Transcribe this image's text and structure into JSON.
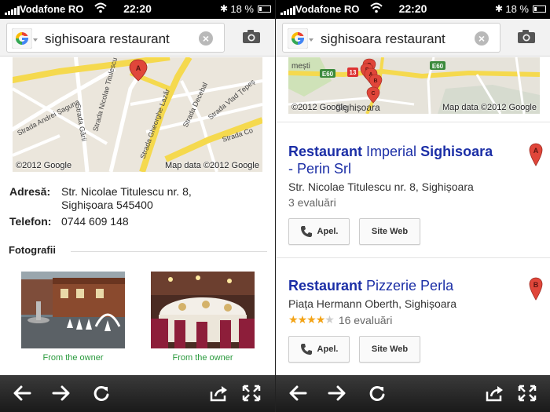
{
  "status_bar": {
    "carrier": "Vodafone RO",
    "time": "22:20",
    "battery": "18 %"
  },
  "search": {
    "query": "sighisoara restaurant",
    "clear_icon": "clear-x-icon",
    "camera_icon": "camera-icon"
  },
  "left_page": {
    "map": {
      "credit_left": "©2012 Google",
      "credit_right": "Map data ©2012 Google",
      "marker_letter": "A",
      "street_labels": [
        "Strada Gării",
        "Strada Nicolae Titulescu",
        "Strada Gheorghe Lazăr",
        "Strada Decebal",
        "Strada Vlad Țepeș",
        "Strada Andrei Șaguna",
        "Strada Co"
      ]
    },
    "address_label": "Adresă:",
    "address_line1": "Str. Nicolae Titulescu nr. 8,",
    "address_line2": "Sighișoara 545400",
    "phone_label": "Telefon:",
    "phone_value": "0744 609 148",
    "photos_heading": "Fotografii",
    "photos": [
      {
        "caption": "From the owner"
      },
      {
        "caption": "From the owner"
      }
    ]
  },
  "right_page": {
    "map": {
      "credit_left": "©2012 Google",
      "credit_right": "Map data ©2012 Google",
      "place_label": "Sighișoara",
      "road_labels": [
        "E60",
        "13",
        "E60"
      ],
      "partial_label": "mești",
      "marker_letters": [
        "D",
        "F",
        "A",
        "B",
        "C"
      ]
    },
    "results": [
      {
        "title_bold1": "Restaurant",
        "title_normal": " Imperial ",
        "title_bold2": "Sighisoara",
        "title_line2": "- Perin Srl",
        "address": "Str. Nicolae Titulescu nr. 8, Sighișoara",
        "reviews": "3 evaluări",
        "marker_letter": "A",
        "call_label": "Apel.",
        "web_label": "Site Web"
      },
      {
        "title_bold1": "Restaurant",
        "title_normal": " Pizzerie Perla",
        "address": "Piața Hermann Oberth, Sighișoara",
        "rating": 4,
        "rating_max": 5,
        "reviews": "16 evaluări",
        "marker_letter": "B",
        "call_label": "Apel.",
        "web_label": "Site Web"
      }
    ]
  },
  "toolbar_icons": [
    "back-arrow-icon",
    "forward-arrow-icon",
    "reload-icon",
    "share-icon",
    "fullscreen-icon"
  ],
  "colors": {
    "link_blue": "#1b2ea6",
    "owner_green": "#2a9a3d",
    "star_gold": "#f3a316",
    "marker_red": "#e0463a"
  }
}
